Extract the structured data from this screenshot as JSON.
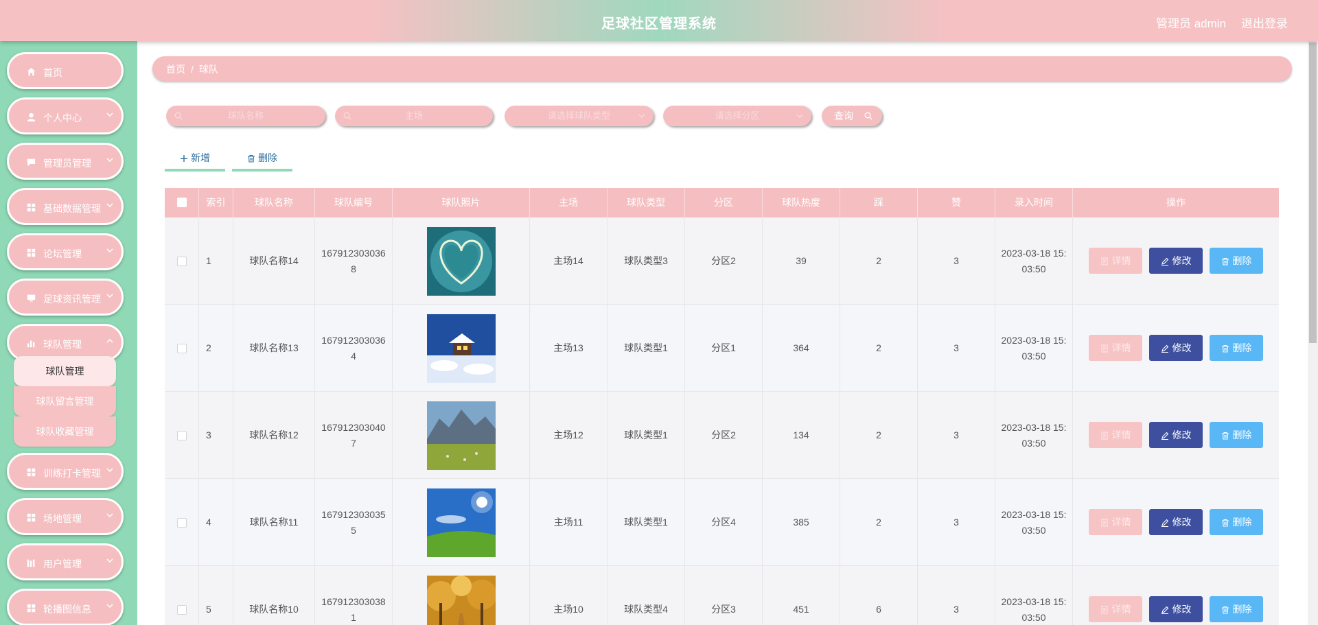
{
  "header": {
    "title": "足球社区管理系统",
    "admin": "管理员 admin",
    "logout": "退出登录"
  },
  "sidebar": {
    "items": [
      {
        "label": "首页",
        "icon": "home-icon"
      },
      {
        "label": "个人中心",
        "icon": "user-icon"
      },
      {
        "label": "管理员管理",
        "icon": "chat-icon"
      },
      {
        "label": "基础数据管理",
        "icon": "grid-icon"
      },
      {
        "label": "论坛管理",
        "icon": "grid-icon"
      },
      {
        "label": "足球资讯管理",
        "icon": "monitor-icon"
      },
      {
        "label": "球队管理",
        "icon": "chart-icon"
      },
      {
        "label": "训练打卡管理",
        "icon": "grid-icon"
      },
      {
        "label": "场地管理",
        "icon": "grid-icon"
      },
      {
        "label": "用户管理",
        "icon": "bars-icon"
      },
      {
        "label": "轮播图信息",
        "icon": "grid-icon"
      }
    ],
    "submenu": [
      {
        "label": "球队管理"
      },
      {
        "label": "球队留言管理"
      },
      {
        "label": "球队收藏管理"
      }
    ]
  },
  "breadcrumb": {
    "home": "首页",
    "sep": "/",
    "current": "球队"
  },
  "filters": {
    "name_placeholder": "球队名称",
    "venue_placeholder": "主场",
    "type_placeholder": "请选择球队类型",
    "zone_placeholder": "请选择分区",
    "search_label": "查询"
  },
  "actions": {
    "add_label": "新增",
    "delete_label": "删除"
  },
  "table": {
    "headers": [
      "索引",
      "球队名称",
      "球队编号",
      "球队照片",
      "主场",
      "球队类型",
      "分区",
      "球队热度",
      "踩",
      "赞",
      "录入时间",
      "操作"
    ],
    "ops": {
      "detail": "详情",
      "edit": "修改",
      "delete": "删除"
    },
    "rows": [
      {
        "index": "1",
        "name": "球队名称14",
        "code": "1679123030368",
        "photo": "heart-island-photo",
        "venue": "主场14",
        "type": "球队类型3",
        "zone": "分区2",
        "heat": "39",
        "down": "2",
        "up": "3",
        "time": "2023-03-18 15:03:50"
      },
      {
        "index": "2",
        "name": "球队名称13",
        "code": "1679123030364",
        "photo": "snow-cabin-photo",
        "venue": "主场13",
        "type": "球队类型1",
        "zone": "分区1",
        "heat": "364",
        "down": "2",
        "up": "3",
        "time": "2023-03-18 15:03:50"
      },
      {
        "index": "3",
        "name": "球队名称12",
        "code": "1679123030407",
        "photo": "mountain-meadow-photo",
        "venue": "主场12",
        "type": "球队类型1",
        "zone": "分区2",
        "heat": "134",
        "down": "2",
        "up": "3",
        "time": "2023-03-18 15:03:50"
      },
      {
        "index": "4",
        "name": "球队名称11",
        "code": "1679123030355",
        "photo": "sunny-field-photo",
        "venue": "主场11",
        "type": "球队类型1",
        "zone": "分区4",
        "heat": "385",
        "down": "2",
        "up": "3",
        "time": "2023-03-18 15:03:50"
      },
      {
        "index": "5",
        "name": "球队名称10",
        "code": "1679123030381",
        "photo": "autumn-road-photo",
        "venue": "主场10",
        "type": "球队类型4",
        "zone": "分区3",
        "heat": "451",
        "down": "6",
        "up": "3",
        "time": "2023-03-18 15:03:50"
      }
    ]
  },
  "colors": {
    "pink": "#f5bfc2",
    "mint": "#8fd9b6",
    "edit": "#3d4f9e",
    "delete": "#58b7f4"
  }
}
